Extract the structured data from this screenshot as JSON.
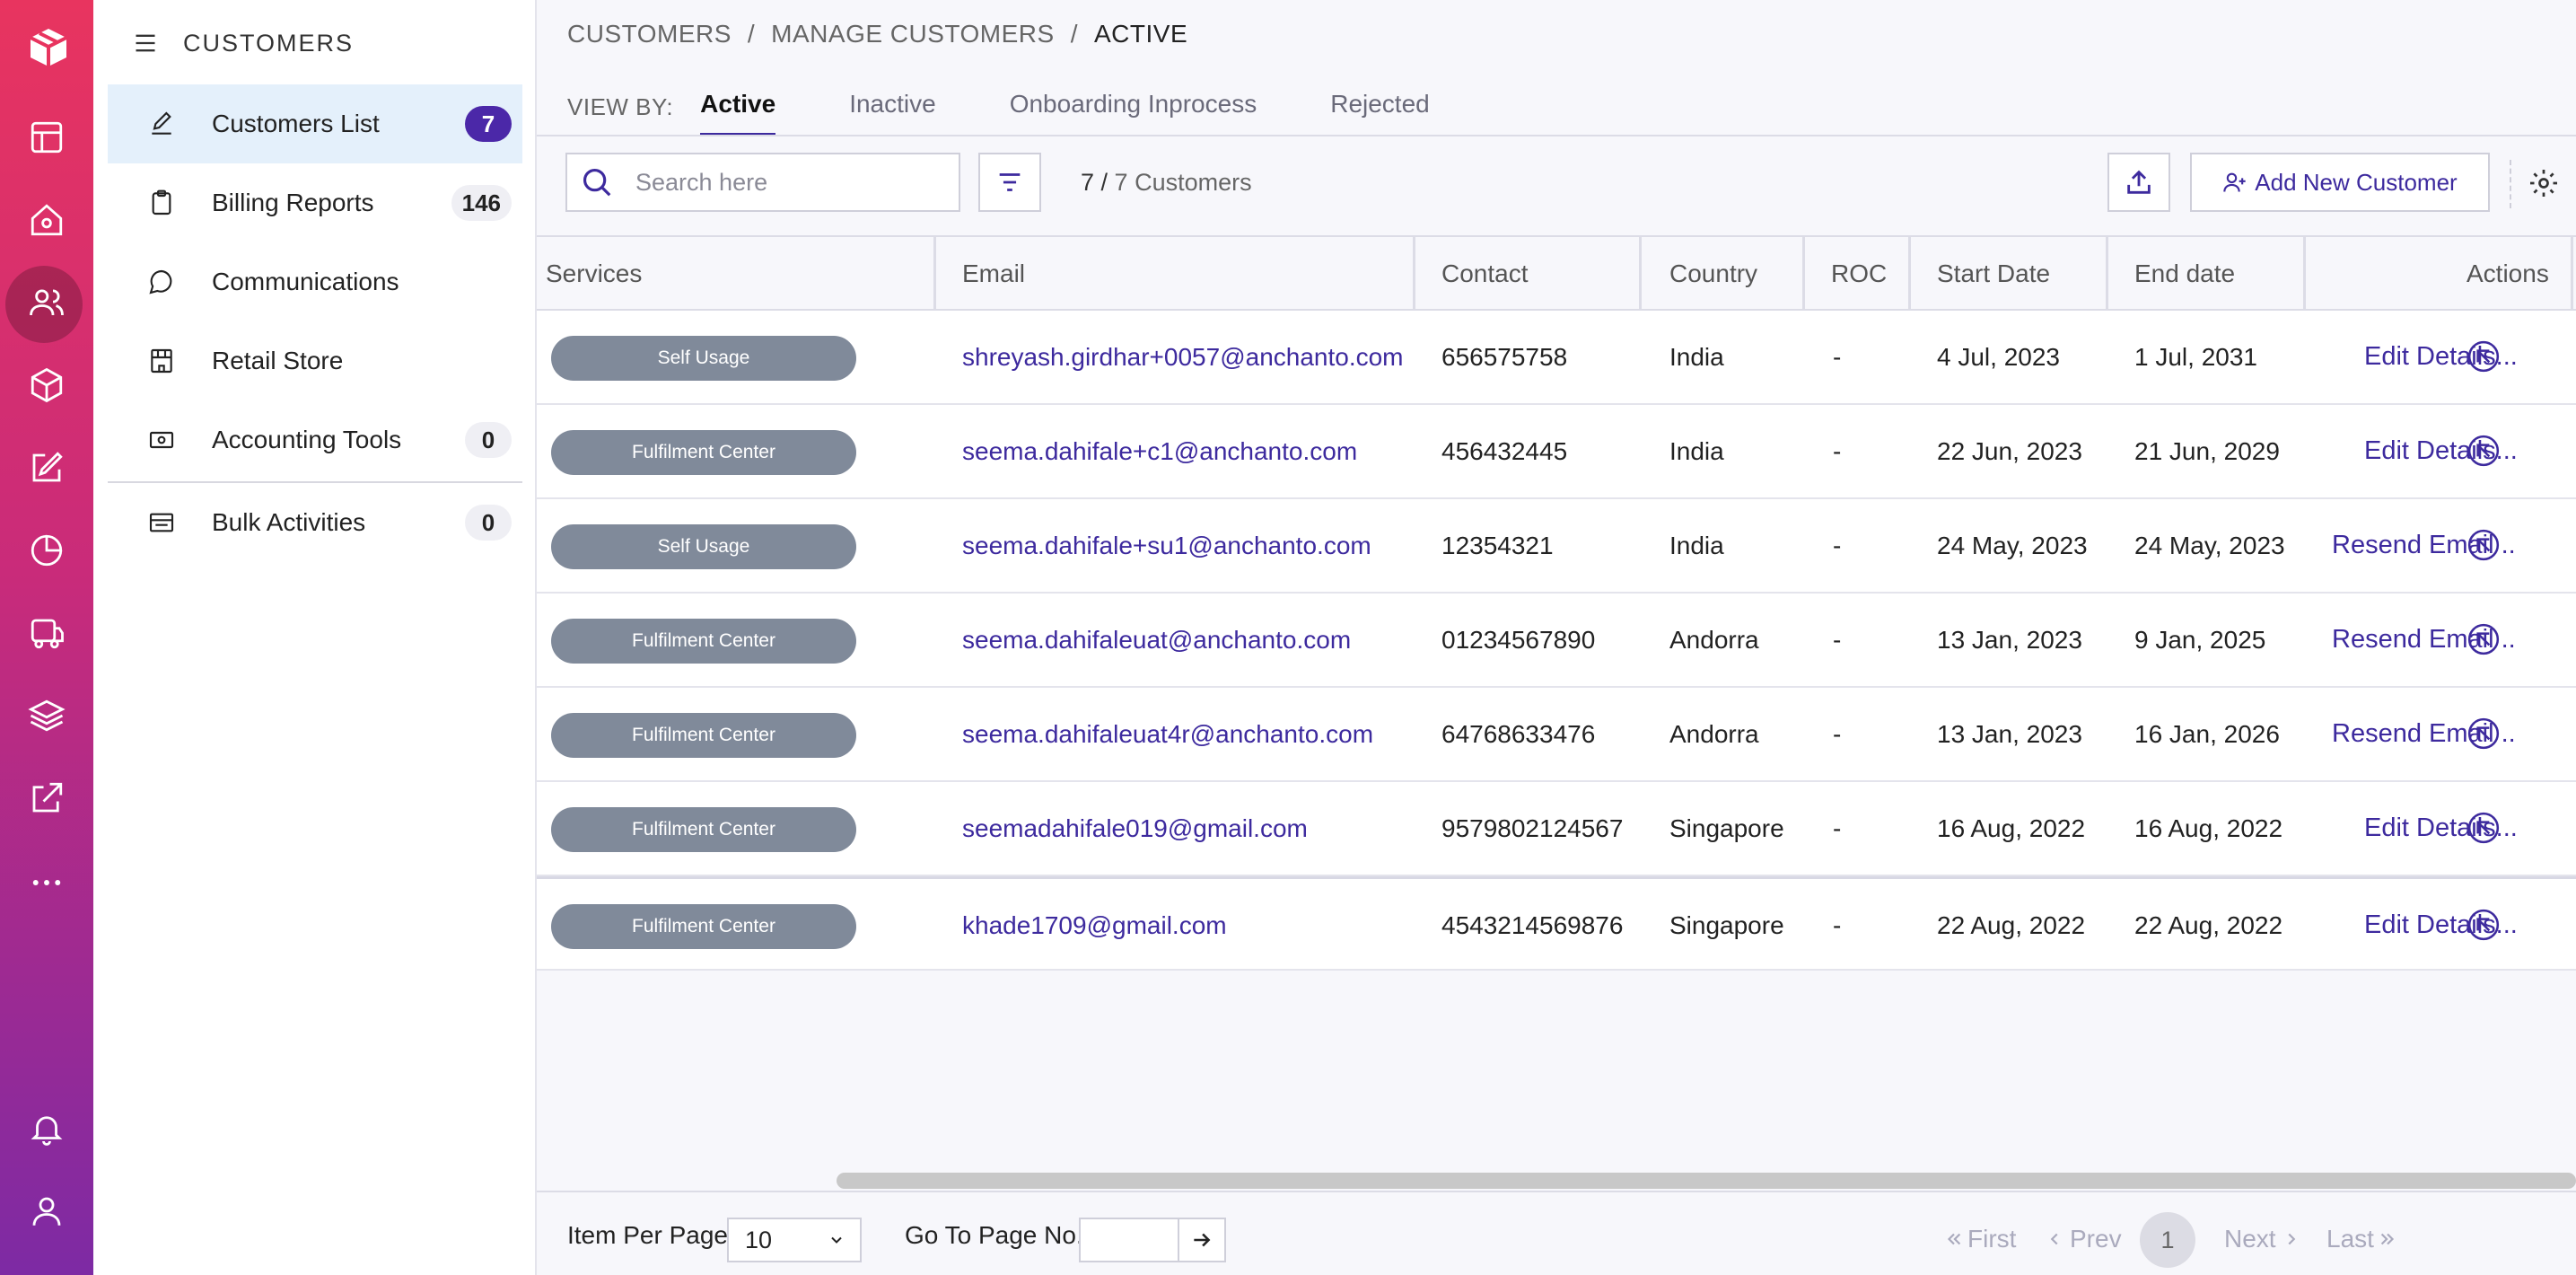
{
  "rail": {
    "items": [
      "layout-icon",
      "home-icon",
      "users-icon",
      "box-icon",
      "edit-icon",
      "pie-chart-icon",
      "truck-icon",
      "layers-icon",
      "external-link-icon",
      "more-icon"
    ],
    "bottom": [
      "bell-icon",
      "user-icon"
    ],
    "active": "users-icon"
  },
  "sidenav": {
    "title": "CUSTOMERS",
    "items": [
      {
        "label": "Customers List",
        "badge": "7",
        "icon": "edit-icon"
      },
      {
        "label": "Billing Reports",
        "badge": "146",
        "icon": "clipboard-icon"
      },
      {
        "label": "Communications",
        "badge": "",
        "icon": "message-icon"
      },
      {
        "label": "Retail Store",
        "badge": "",
        "icon": "store-icon"
      },
      {
        "label": "Accounting Tools",
        "badge": "0",
        "icon": "cash-icon"
      },
      {
        "label": "Bulk Activities",
        "badge": "0",
        "icon": "list-icon"
      }
    ]
  },
  "breadcrumb": {
    "items": [
      "CUSTOMERS",
      "MANAGE CUSTOMERS",
      "ACTIVE"
    ],
    "sep": "/"
  },
  "tabs": {
    "view_by": "VIEW BY:",
    "items": [
      "Active",
      "Inactive",
      "Onboarding Inprocess",
      "Rejected"
    ],
    "active": "Active"
  },
  "toolbar": {
    "search_placeholder": "Search here",
    "count_shown": "7 /",
    "count_total": "7 Customers",
    "add_label": "Add New Customer"
  },
  "table": {
    "columns": [
      "Services",
      "Email",
      "Contact",
      "Country",
      "ROC",
      "Start Date",
      "End date",
      "Actions"
    ],
    "rows": [
      {
        "service": "Self Usage",
        "email": "shreyash.girdhar+0057@anchanto.com",
        "contact": "656575758",
        "country": "India",
        "roc": "-",
        "start": "4 Jul, 2023",
        "end": "1 Jul, 2031",
        "action": "Edit Details..."
      },
      {
        "service": "Fulfilment Center",
        "email": "seema.dahifale+c1@anchanto.com",
        "contact": "456432445",
        "country": "India",
        "roc": "-",
        "start": "22 Jun, 2023",
        "end": "21 Jun, 2029",
        "action": "Edit Details..."
      },
      {
        "service": "Self Usage",
        "email": "seema.dahifale+su1@anchanto.com",
        "contact": "12354321",
        "country": "India",
        "roc": "-",
        "start": "24 May, 2023",
        "end": "24 May, 2023",
        "action": "Resend Email  .."
      },
      {
        "service": "Fulfilment Center",
        "email": "seema.dahifaleuat@anchanto.com",
        "contact": "01234567890",
        "country": "Andorra",
        "roc": "-",
        "start": "13 Jan, 2023",
        "end": "9 Jan, 2025",
        "action": "Resend Email  .."
      },
      {
        "service": "Fulfilment Center",
        "email": "seema.dahifaleuat4r@anchanto.com",
        "contact": "64768633476",
        "country": "Andorra",
        "roc": "-",
        "start": "13 Jan, 2023",
        "end": "16 Jan, 2026",
        "action": "Resend Email  .."
      },
      {
        "service": "Fulfilment Center",
        "email": "seemadahifale019@gmail.com",
        "contact": "9579802124567",
        "country": "Singapore",
        "roc": "-",
        "start": "16 Aug, 2022",
        "end": "16 Aug, 2022",
        "action": "Edit Details..."
      },
      {
        "service": "Fulfilment Center",
        "email": "khade1709@gmail.com",
        "contact": "4543214569876",
        "country": "Singapore",
        "roc": "-",
        "start": "22 Aug, 2022",
        "end": "22 Aug, 2022",
        "action": "Edit Details..."
      }
    ]
  },
  "footer": {
    "item_per_page_label": "Item Per Page",
    "item_per_page_value": "10",
    "goto_label": "Go To Page No.",
    "first": "First",
    "prev": "Prev",
    "page": "1",
    "next": "Next",
    "last": "Last"
  },
  "colors": {
    "accent": "#3d2a9e",
    "badge_active": "#4b28a8",
    "pill": "#808a9a",
    "rail_top": "#e8345f",
    "rail_bottom": "#7d2aa4"
  }
}
